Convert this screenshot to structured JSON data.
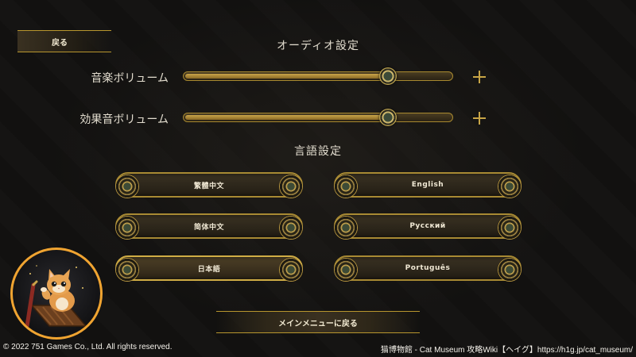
{
  "back_button": {
    "label": "戻る"
  },
  "audio_section": {
    "title": "オーディオ設定"
  },
  "sliders": [
    {
      "label": "音楽ボリューム",
      "value": 0.76
    },
    {
      "label": "効果音ボリューム",
      "value": 0.76
    }
  ],
  "language_section": {
    "title": "言語設定"
  },
  "languages": [
    {
      "label": "繁體中文",
      "selected": false
    },
    {
      "label": "English",
      "selected": false
    },
    {
      "label": "简体中文",
      "selected": false
    },
    {
      "label": "Русский",
      "selected": false
    },
    {
      "label": "日本語",
      "selected": true
    },
    {
      "label": "Português",
      "selected": false
    }
  ],
  "main_menu_button": {
    "label": "メインメニューに戻る"
  },
  "footer": {
    "copyright": "© 2022 751 Games Co., Ltd. All rights reserved.",
    "source": "猫博物館 - Cat Museum 攻略Wiki【ヘイグ】https://h1g.jp/cat_museum/"
  },
  "colors": {
    "accent_gold": "#c8a546",
    "avatar_ring": "#f0a431",
    "background": "#121110"
  }
}
